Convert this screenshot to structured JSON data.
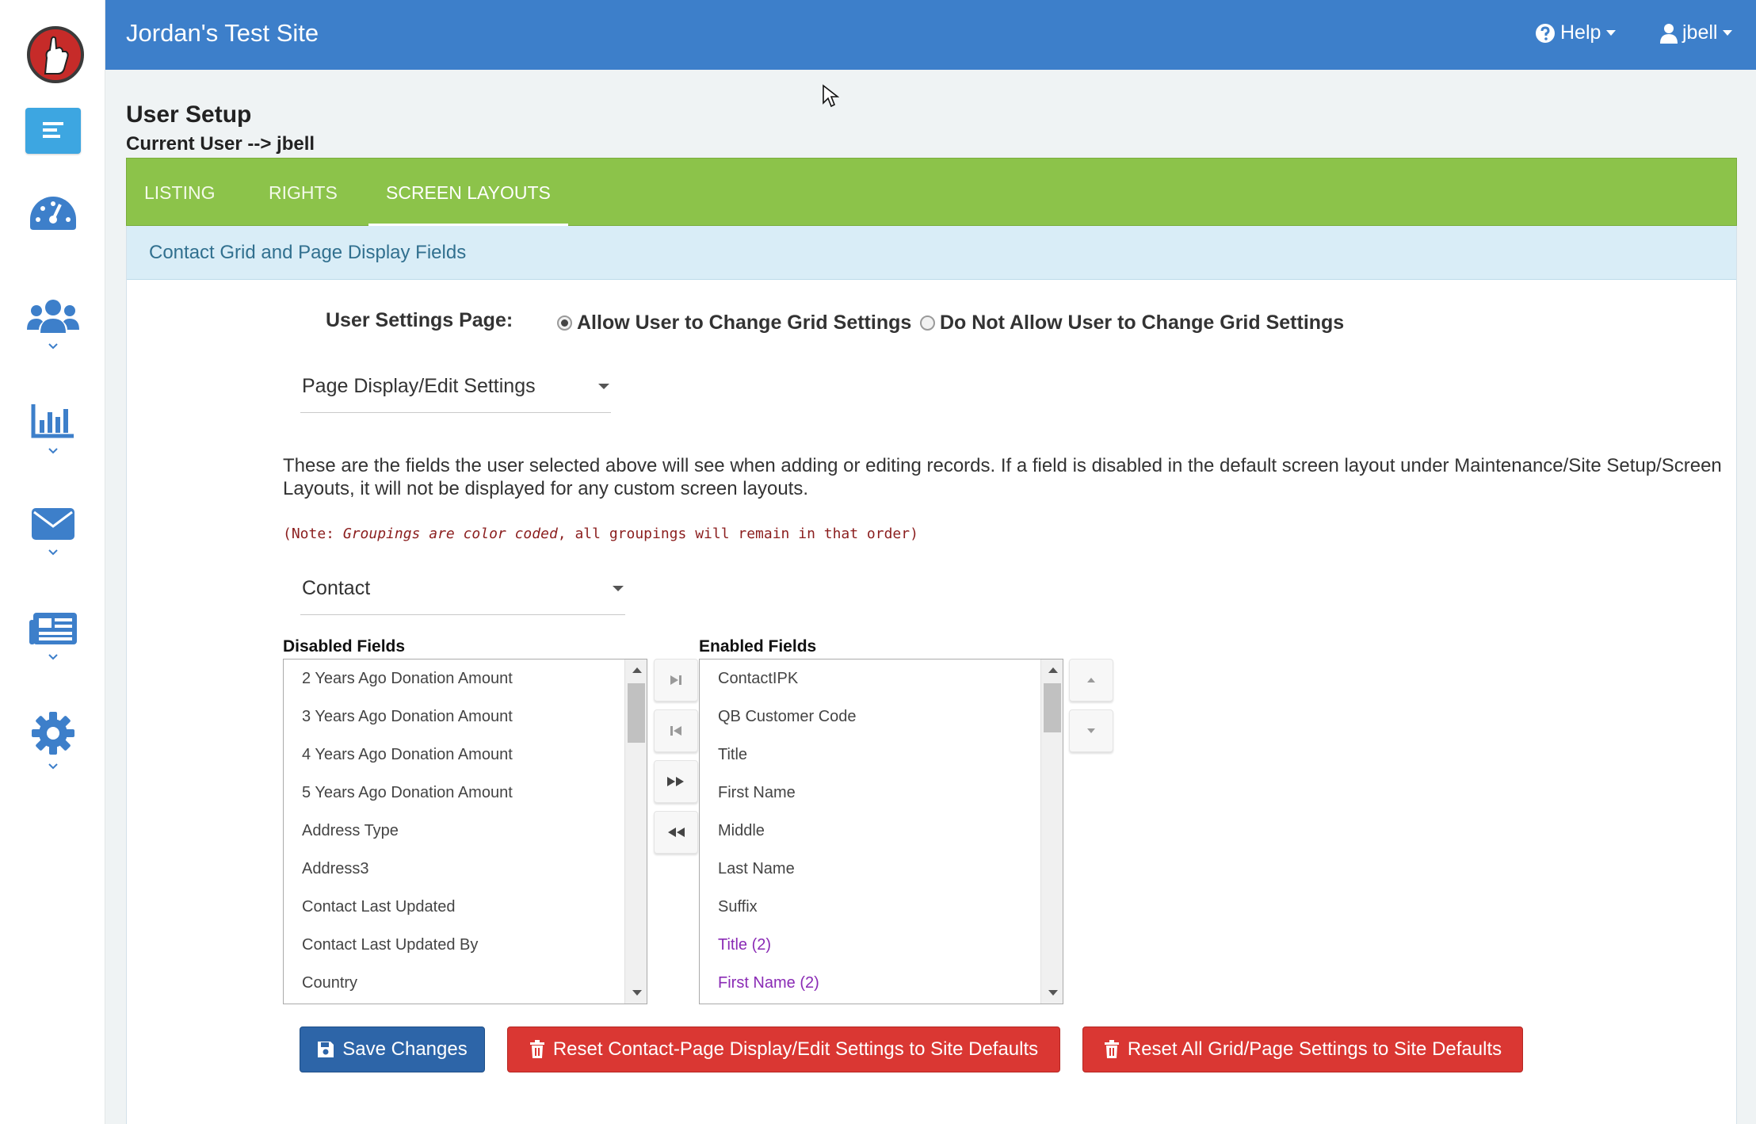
{
  "header": {
    "site_title": "Jordan's Test Site",
    "help_label": "Help",
    "user_label": "jbell"
  },
  "page": {
    "title": "User Setup",
    "subtitle": "Current User --> jbell"
  },
  "tabs": [
    {
      "label": "LISTING"
    },
    {
      "label": "RIGHTS"
    },
    {
      "label": "SCREEN LAYOUTS"
    }
  ],
  "panel": {
    "heading": "Contact Grid and Page Display Fields",
    "settings_label": "User Settings Page:",
    "radio_allow": "Allow User to Change Grid Settings",
    "radio_deny": "Do Not Allow User to Change Grid Settings",
    "settings_select": "Page Display/Edit Settings",
    "description": "These are the fields the user selected above will see when adding or editing records. If a field is disabled in the default screen layout under Maintenance/Site Setup/Screen Layouts, it will not be displayed for any custom screen layouts.",
    "note_prefix": "(Note: ",
    "note_emph": "Groupings are color coded",
    "note_suffix": ", all groupings will remain in that order)",
    "entity_select": "Contact"
  },
  "disabled_fields": {
    "label": "Disabled Fields",
    "items": [
      "2 Years Ago Donation Amount",
      "3 Years Ago Donation Amount",
      "4 Years Ago Donation Amount",
      "5 Years Ago Donation Amount",
      "Address Type",
      "Address3",
      "Contact Last Updated",
      "Contact Last Updated By",
      "Country"
    ]
  },
  "enabled_fields": {
    "label": "Enabled Fields",
    "items": [
      "ContactIPK",
      "QB Customer Code",
      "Title",
      "First Name",
      "Middle",
      "Last Name",
      "Suffix",
      "Title (2)",
      "First Name (2)"
    ],
    "group2_color": "#8a2bb5"
  },
  "buttons": {
    "save": "Save Changes",
    "reset_page": "Reset Contact-Page Display/Edit Settings to Site Defaults",
    "reset_all": "Reset All Grid/Page Settings to Site Defaults"
  },
  "colors": {
    "topbar": "#3d7fca",
    "tabbar": "#8cc34a",
    "panel_head": "#d9edf7",
    "primary": "#2d65a8",
    "danger": "#da3733",
    "sidebar_active": "#3da6e1",
    "icon": "#3d7fca"
  }
}
